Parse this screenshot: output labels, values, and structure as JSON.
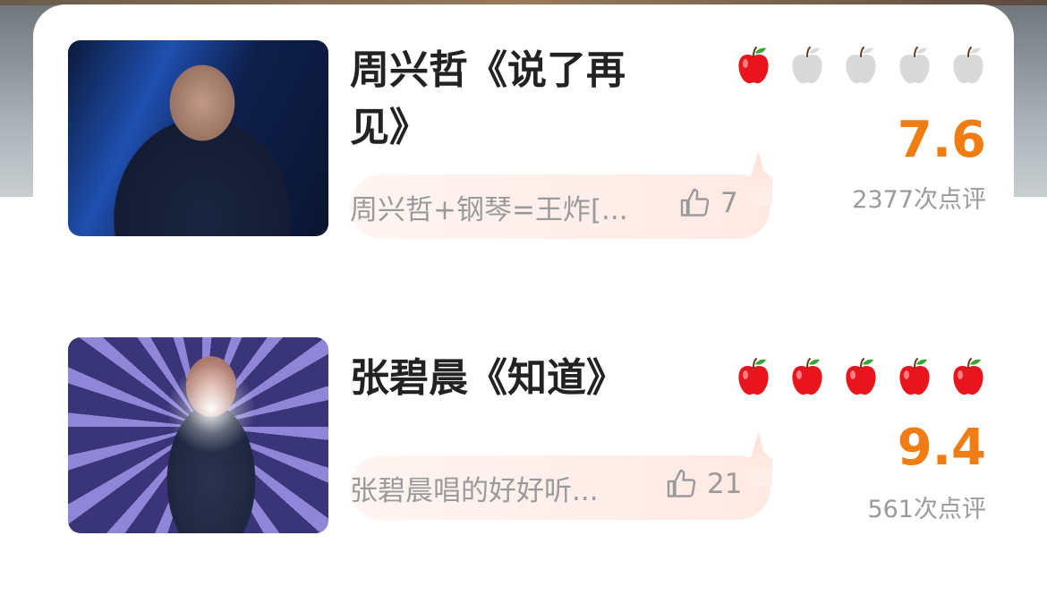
{
  "items": [
    {
      "title": "周兴哲《说了再见》",
      "comment": "周兴哲+钢琴=王炸[...",
      "likes": "7",
      "score": "7.6",
      "reviews": "2377次点评",
      "apples_filled": 1,
      "apples_total": 5
    },
    {
      "title": "张碧晨《知道》",
      "comment": "张碧晨唱的好好听...",
      "likes": "21",
      "score": "9.4",
      "reviews": "561次点评",
      "apples_filled": 5,
      "apples_total": 5
    }
  ],
  "colors": {
    "score": "#f07d14",
    "apple_filled": "#e8161c",
    "apple_empty": "#d9d9d9",
    "muted_text": "#9a9a9a"
  },
  "icons": {
    "rating": "apple-icon",
    "like": "thumbs-up-icon"
  }
}
